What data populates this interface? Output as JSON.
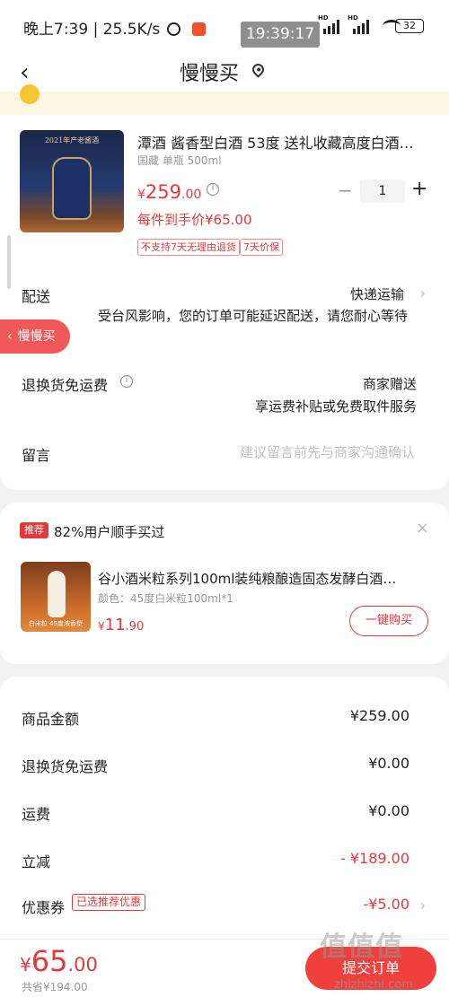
{
  "status_bar": {
    "time_speed": "晚上7:39 | 25.5K/s",
    "clock_overlay": "19:39:17",
    "battery": "32",
    "signal1": "HD",
    "signal2": "HD"
  },
  "nav": {
    "title": "慢慢买",
    "back_icon": "back-chevron-icon",
    "location_icon": "location-pin-icon"
  },
  "product": {
    "image_caption": "2021年产老酱酒",
    "title": "潭酒 酱香型白酒 53度 送礼收藏高度白酒…",
    "spec": "国藏 单瓶 500ml",
    "price_symbol": "¥",
    "price_int": "259",
    "price_dec": ".00",
    "arrive_price": "每件到手价¥65.00",
    "qty": "1",
    "tags": [
      "不支持7天无理由退货",
      "7天价保"
    ]
  },
  "delivery": {
    "label": "配送",
    "value": "快递运输",
    "note": "受台风影响，您的订单可能延迟配送，请您耐心等待"
  },
  "return_fee": {
    "label": "退换货免运费",
    "value": "商家赠送",
    "sub": "享运费补贴或免费取件服务"
  },
  "message": {
    "label": "留言",
    "placeholder": "建议留言前先与商家沟通确认"
  },
  "float_button": {
    "label": "慢慢买"
  },
  "recommend": {
    "badge": "推荐",
    "text": "82%用户顺手买过",
    "image_caption": "白米粒 45度浓香型",
    "title": "谷小酒米粒系列100ml装纯粮酿造固态发酵白酒…",
    "spec": "颜色：45度白米粒100ml*1",
    "price_symbol": "¥",
    "price_int": "11",
    "price_dec": ".90",
    "buy_label": "一键购买"
  },
  "summary": {
    "rows": [
      {
        "label": "商品金额",
        "value": "¥259.00"
      },
      {
        "label": "退换货免运费",
        "value": "¥0.00"
      },
      {
        "label": "运费",
        "value": "¥0.00"
      },
      {
        "label": "立减",
        "value": "- ¥189.00"
      },
      {
        "label": "优惠券",
        "value": "-¥5.00"
      }
    ],
    "coupon_tag": "已选推荐优惠"
  },
  "bottom": {
    "total_symbol": "¥",
    "total_int": "65",
    "total_dec": ".00",
    "total_sub": "共省¥194.00",
    "submit_label": "提交订单"
  },
  "watermark": {
    "text": "值值值",
    "sub": "zhizhizhi.com"
  },
  "colors": {
    "accent_red": "#e4393c",
    "button_red": "#f0403d",
    "float_button": "#f2585a"
  }
}
